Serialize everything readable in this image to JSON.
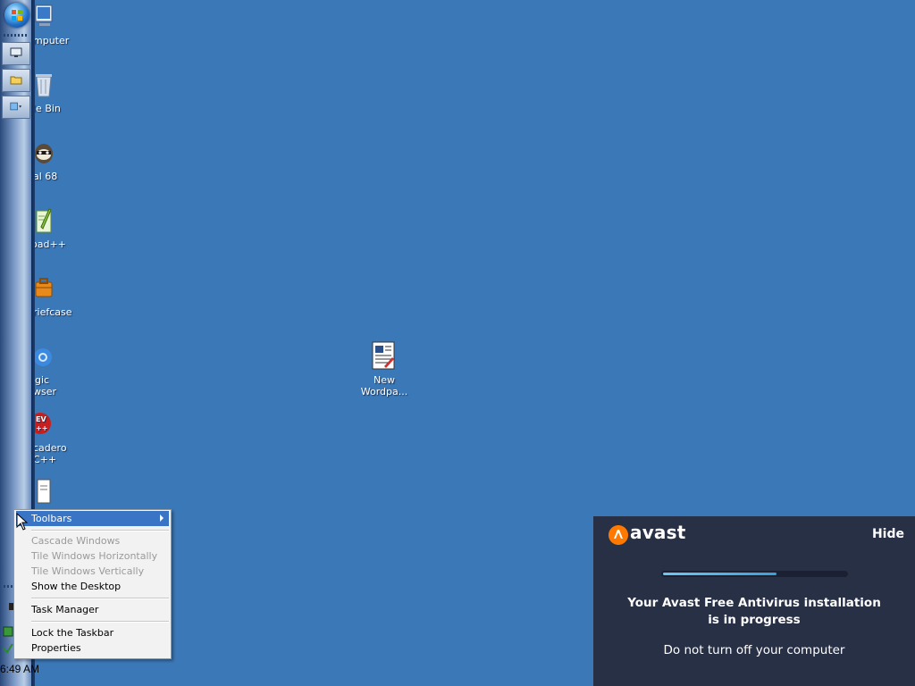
{
  "desktop": {
    "background_color": "#3b78b8",
    "icons": [
      {
        "name": "computer",
        "lines": [
          "mputer"
        ],
        "icon": "computer-icon"
      },
      {
        "name": "recycle-bin",
        "lines": [
          "le Bin"
        ],
        "icon": "recycle-bin-icon"
      },
      {
        "name": "al68",
        "lines": [
          "al 68"
        ],
        "icon": "raccoon-icon"
      },
      {
        "name": "notepadpp",
        "lines": [
          "oad++"
        ],
        "icon": "notepad-plus-icon"
      },
      {
        "name": "briefcase",
        "lines": [
          "riefcase"
        ],
        "icon": "briefcase-icon"
      },
      {
        "name": "magic-browser",
        "lines": [
          "gic",
          "wser"
        ],
        "icon": "browser-icon"
      },
      {
        "name": "embarcadero-cpp",
        "lines": [
          "cadero",
          "C++"
        ],
        "icon": "dev-cpp-icon"
      },
      {
        "name": "document",
        "lines": [],
        "icon": "document-icon"
      },
      {
        "name": "new-wordpad",
        "lines": [
          "New",
          "Wordpa..."
        ],
        "icon": "wordpad-document-icon"
      }
    ]
  },
  "taskbar": {
    "orientation": "left",
    "quick_launch": [
      {
        "name": "show-desktop",
        "icon": "monitor-icon"
      },
      {
        "name": "explorer",
        "icon": "folder-icon"
      },
      {
        "name": "internet",
        "icon": "web-icon"
      }
    ],
    "clock": "6:49 AM"
  },
  "context_menu": {
    "items": [
      {
        "label": "Toolbars",
        "state": "highlighted",
        "submenu": true
      },
      {
        "label": "Cascade Windows",
        "state": "disabled"
      },
      {
        "label": "Tile Windows Horizontally",
        "state": "disabled"
      },
      {
        "label": "Tile Windows Vertically",
        "state": "disabled"
      },
      {
        "label": "Show the Desktop",
        "state": "normal"
      },
      {
        "label": "Task Manager",
        "state": "normal"
      },
      {
        "label": "Lock the Taskbar",
        "state": "normal"
      },
      {
        "label": "Properties",
        "state": "normal"
      }
    ]
  },
  "avast": {
    "brand": "avast",
    "hide_label": "Hide",
    "progress": 0.62,
    "message_line1": "Your Avast Free Antivirus installation",
    "message_line2": "is in progress",
    "warning": "Do not turn off your computer",
    "accent_color": "#ff7800",
    "bg_color": "#283046"
  }
}
